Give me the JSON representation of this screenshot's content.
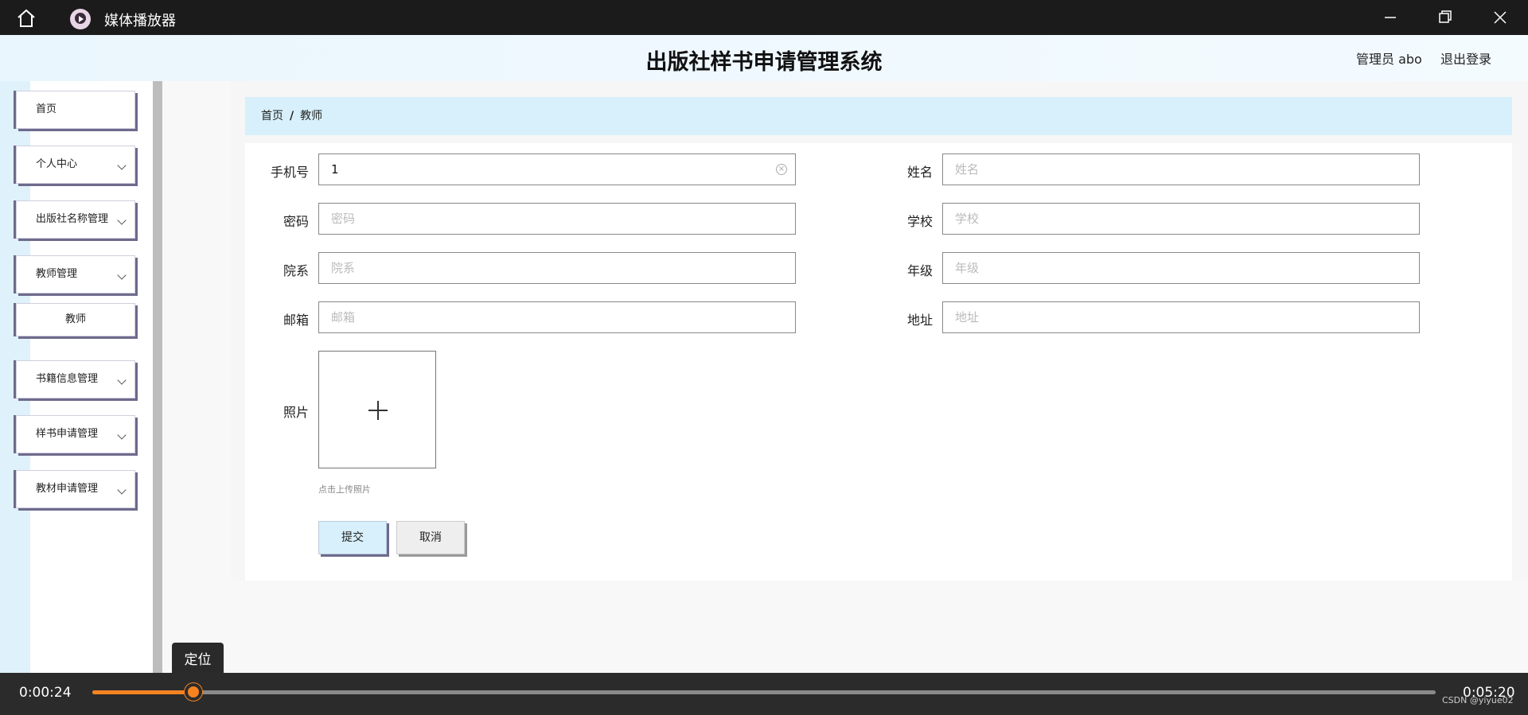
{
  "window": {
    "title": "媒体播放器"
  },
  "header": {
    "system_title": "出版社样书申请管理系统",
    "admin_label": "管理员 abo",
    "logout_label": "退出登录"
  },
  "sidebar": {
    "items": [
      {
        "label": "首页"
      },
      {
        "label": "个人中心"
      },
      {
        "label": "出版社名称管理"
      },
      {
        "label": "教师管理"
      },
      {
        "label": "教师"
      },
      {
        "label": "书籍信息管理"
      },
      {
        "label": "样书申请管理"
      },
      {
        "label": "教材申请管理"
      }
    ]
  },
  "breadcrumb": {
    "home": "首页",
    "separator": "/",
    "current": "教师"
  },
  "form": {
    "phone": {
      "label": "手机号",
      "value": "1"
    },
    "name": {
      "label": "姓名",
      "placeholder": "姓名"
    },
    "password": {
      "label": "密码",
      "placeholder": "密码"
    },
    "school": {
      "label": "学校",
      "placeholder": "学校"
    },
    "department": {
      "label": "院系",
      "placeholder": "院系"
    },
    "grade": {
      "label": "年级",
      "placeholder": "年级"
    },
    "email": {
      "label": "邮箱",
      "placeholder": "邮箱"
    },
    "address": {
      "label": "地址",
      "placeholder": "地址"
    },
    "photo": {
      "label": "照片",
      "hint": "点击上传照片"
    },
    "submit_label": "提交",
    "cancel_label": "取消"
  },
  "player": {
    "tooltip": "定位",
    "current_time": "0:00:24",
    "total_time": "0:05:20",
    "progress_fraction": 0.075,
    "watermark": "CSDN @yiyue02",
    "accent_color": "#f58220"
  }
}
